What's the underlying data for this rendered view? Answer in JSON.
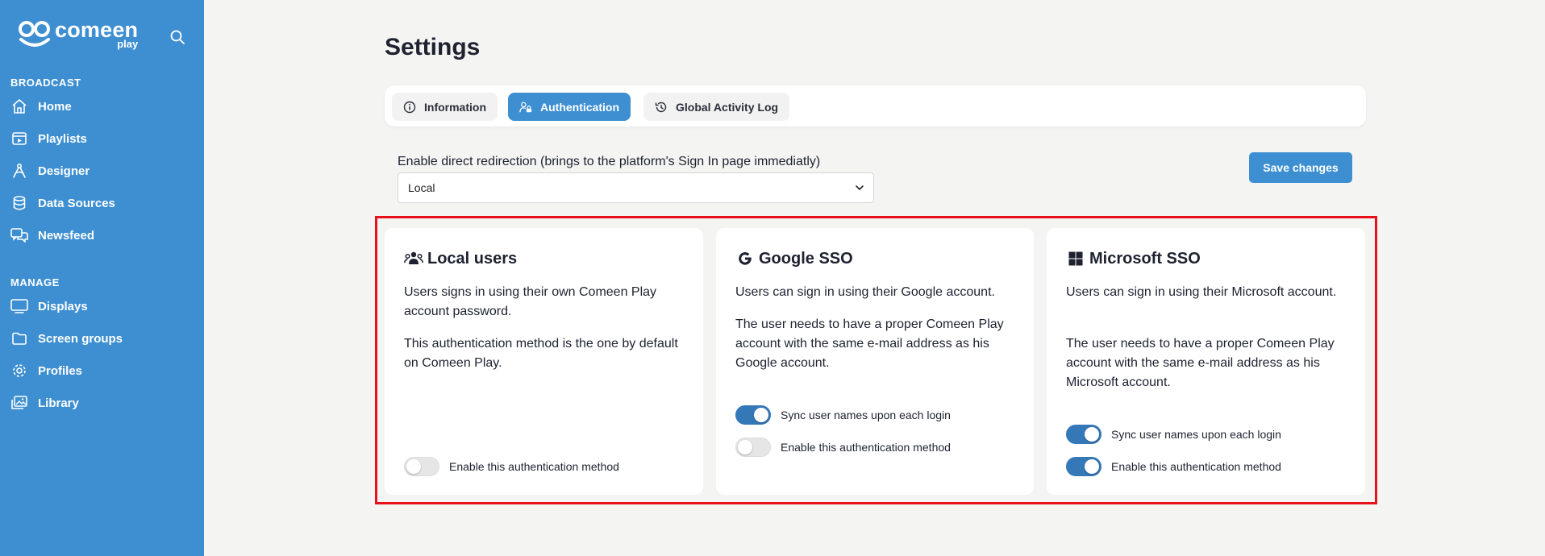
{
  "sidebar": {
    "brand": {
      "name": "comeen",
      "sub": "play"
    },
    "sections": [
      {
        "title": "BROADCAST",
        "items": [
          {
            "label": "Home",
            "icon": "home-icon"
          },
          {
            "label": "Playlists",
            "icon": "playlist-icon"
          },
          {
            "label": "Designer",
            "icon": "designer-icon"
          },
          {
            "label": "Data Sources",
            "icon": "database-icon"
          },
          {
            "label": "Newsfeed",
            "icon": "newsfeed-icon"
          }
        ]
      },
      {
        "title": "MANAGE",
        "items": [
          {
            "label": "Displays",
            "icon": "monitor-icon"
          },
          {
            "label": "Screen groups",
            "icon": "folder-icon"
          },
          {
            "label": "Profiles",
            "icon": "gear-icon"
          },
          {
            "label": "Library",
            "icon": "images-icon"
          }
        ]
      }
    ]
  },
  "page": {
    "title": "Settings"
  },
  "tabs": [
    {
      "label": "Information",
      "icon": "info-icon",
      "active": false
    },
    {
      "label": "Authentication",
      "icon": "user-lock-icon",
      "active": true
    },
    {
      "label": "Global Activity Log",
      "icon": "history-icon",
      "active": false
    }
  ],
  "redirection": {
    "label": "Enable direct redirection (brings to the platform's Sign In page immediatly)",
    "selected": "Local"
  },
  "save_label": "Save changes",
  "colors": {
    "accent": "#3d8fd1",
    "toggle_on": "#3578b8",
    "highlight": "#e8101a"
  },
  "cards": [
    {
      "title": "Local users",
      "icon": "users-icon",
      "paragraphs": [
        "Users signs in using their own Comeen Play account password.",
        "This authentication method is the one by default on Comeen Play."
      ],
      "toggles": [
        {
          "label": "Enable this authentication method",
          "on": false
        }
      ]
    },
    {
      "title": "Google SSO",
      "icon": "google-icon",
      "paragraphs": [
        "Users can sign in using their Google account.",
        "The user needs to have a proper Comeen Play account with the same e-mail address as his Google account."
      ],
      "toggles": [
        {
          "label": "Sync user names upon each login",
          "on": true
        },
        {
          "label": "Enable this authentication method",
          "on": false
        }
      ]
    },
    {
      "title": "Microsoft SSO",
      "icon": "microsoft-icon",
      "paragraphs": [
        "Users can sign in using their Microsoft account.",
        "The user needs to have a proper Comeen Play account with the same e-mail address as his Microsoft account."
      ],
      "toggles": [
        {
          "label": "Sync user names upon each login",
          "on": true
        },
        {
          "label": "Enable this authentication method",
          "on": true
        }
      ]
    }
  ]
}
